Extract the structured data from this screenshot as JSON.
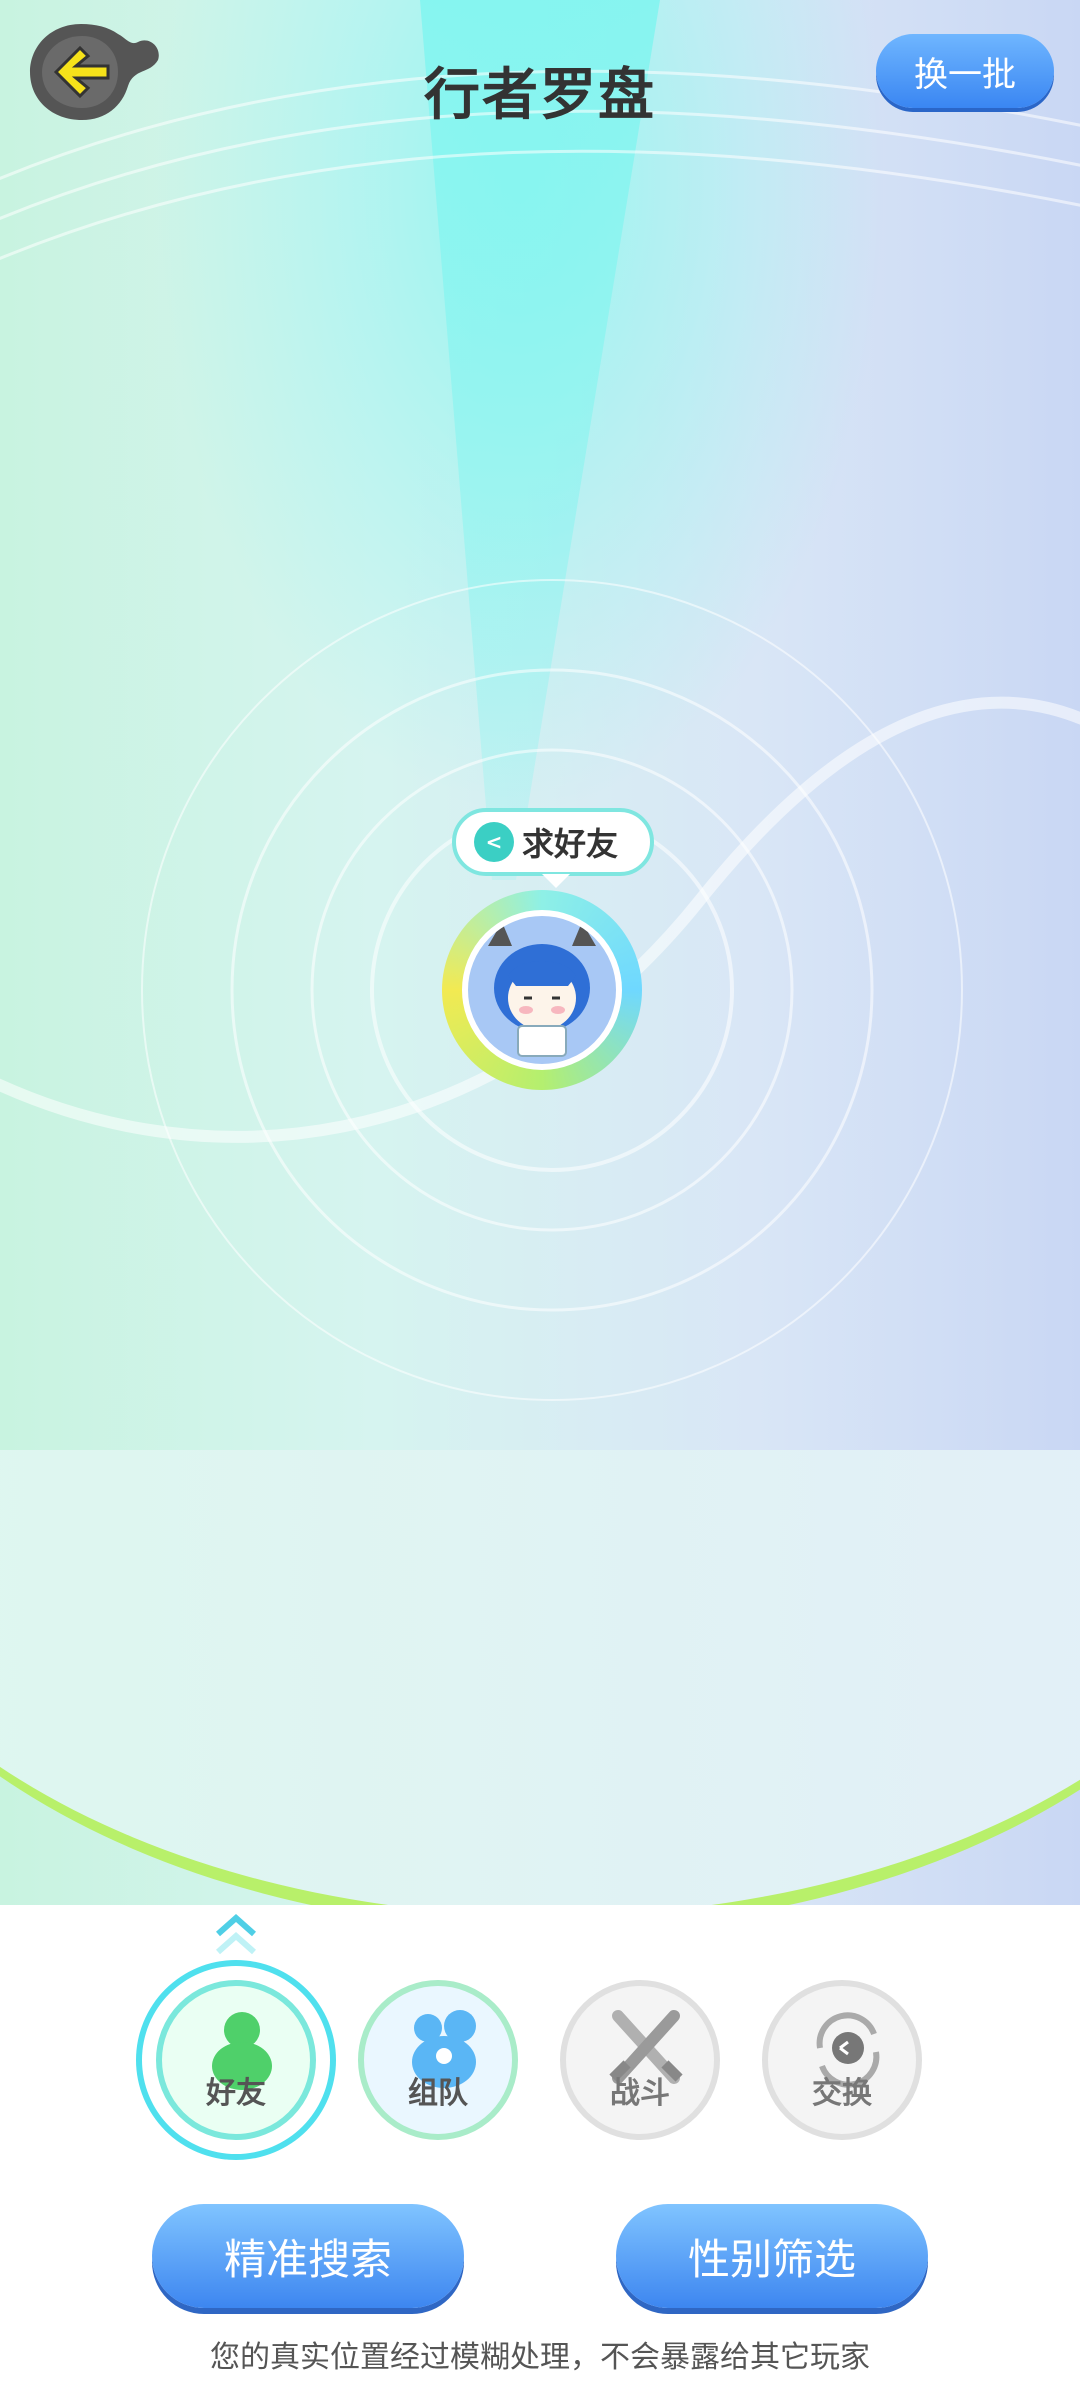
{
  "header": {
    "title": "行者罗盘",
    "refresh_label": "换一批"
  },
  "player": {
    "tag_label": "求好友"
  },
  "categories": [
    {
      "label": "好友",
      "selected": true
    },
    {
      "label": "组队",
      "selected": false
    },
    {
      "label": "战斗",
      "selected": false
    },
    {
      "label": "交换",
      "selected": false
    }
  ],
  "actions": {
    "search_label": "精准搜索",
    "gender_label": "性别筛选"
  },
  "footer": {
    "privacy_note": "您的真实位置经过模糊处理，不会暴露给其它玩家"
  },
  "colors": {
    "accent_blue": "#3d86f0",
    "accent_cyan": "#4fe0ee",
    "accent_green": "#b8f06a",
    "back_arrow": "#f6e21a"
  }
}
